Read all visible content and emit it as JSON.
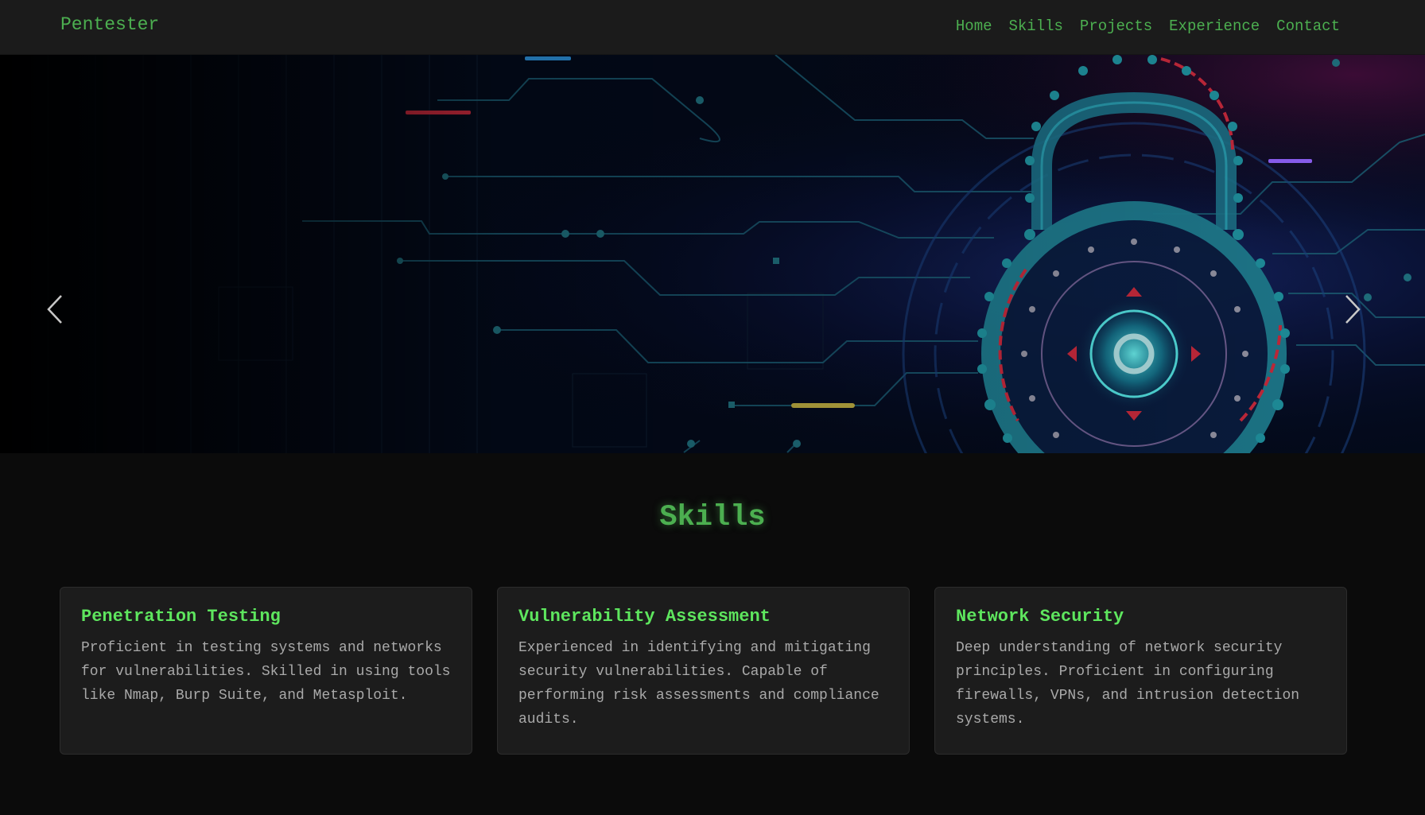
{
  "nav": {
    "brand": "Pentester",
    "links": [
      "Home",
      "Skills",
      "Projects",
      "Experience",
      "Contact"
    ]
  },
  "hero": {
    "image": "cyber-security-padlock-circuit-illustration",
    "prev_icon": "chevron-left-icon",
    "next_icon": "chevron-right-icon"
  },
  "skills": {
    "title": "Skills",
    "cards": [
      {
        "title": "Penetration Testing",
        "text": "Proficient in testing systems and networks for vulnerabilities. Skilled in using tools like Nmap, Burp Suite, and Metasploit."
      },
      {
        "title": "Vulnerability Assessment",
        "text": "Experienced in identifying and mitigating security vulnerabilities. Capable of performing risk assessments and compliance audits."
      },
      {
        "title": "Network Security",
        "text": "Deep understanding of network security principles. Proficient in configuring firewalls, VPNs, and intrusion detection systems."
      }
    ]
  },
  "colors": {
    "accent": "#4caf50",
    "card_title": "#5ee65e",
    "background": "#0b0b0b",
    "navbar": "#1b1b1b",
    "card": "#1c1c1c"
  }
}
